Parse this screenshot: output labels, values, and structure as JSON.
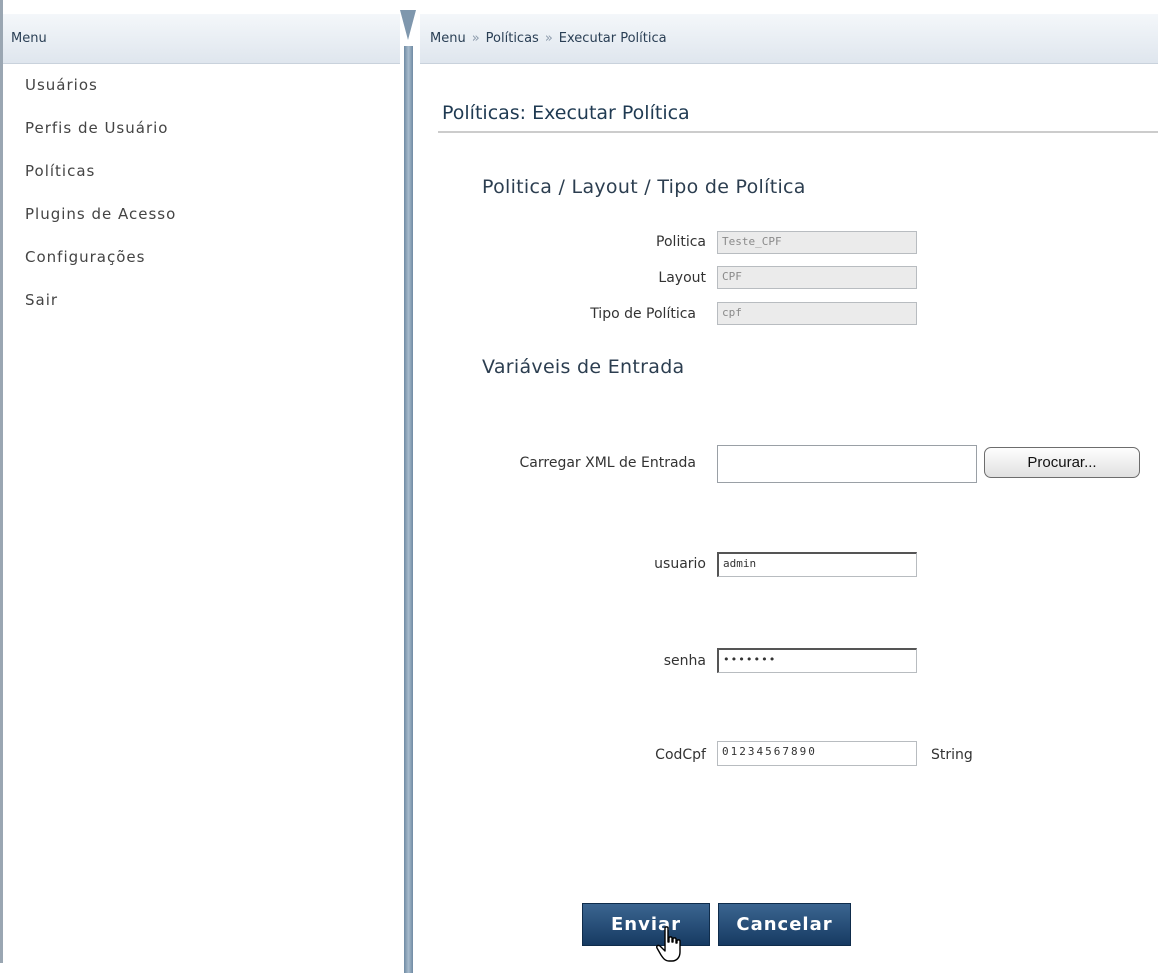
{
  "sidebar": {
    "title": "Menu",
    "items": [
      {
        "label": "Usuários"
      },
      {
        "label": "Perfis de Usuário"
      },
      {
        "label": "Políticas"
      },
      {
        "label": "Plugins de Acesso"
      },
      {
        "label": "Configurações"
      },
      {
        "label": "Sair"
      }
    ]
  },
  "breadcrumb": {
    "items": [
      "Menu",
      "Políticas",
      "Executar Política"
    ],
    "separator": "»"
  },
  "page": {
    "title": "Políticas: Executar Política"
  },
  "policy_section": {
    "title": "Politica / Layout / Tipo de Política",
    "fields": [
      {
        "label": "Politica",
        "value": "Teste_CPF"
      },
      {
        "label": "Layout",
        "value": "CPF"
      },
      {
        "label": "Tipo de Política",
        "value": "cpf"
      }
    ]
  },
  "input_section": {
    "title": "Variáveis de Entrada",
    "xml_label": "Carregar XML de Entrada",
    "browse_label": "Procurar...",
    "usuario_label": "usuario",
    "usuario_value": "admin",
    "senha_label": "senha",
    "senha_value": "•••••••",
    "codcpf_label": "CodCpf",
    "codcpf_value": "01234567890",
    "codcpf_type": "String"
  },
  "actions": {
    "submit_label": "Enviar",
    "cancel_label": "Cancelar"
  },
  "colors": {
    "header_gradient_top": "#f4f7fa",
    "header_gradient_bottom": "#dfe6ee",
    "button_blue": "#1f4670",
    "title_color": "#1f3a52"
  }
}
